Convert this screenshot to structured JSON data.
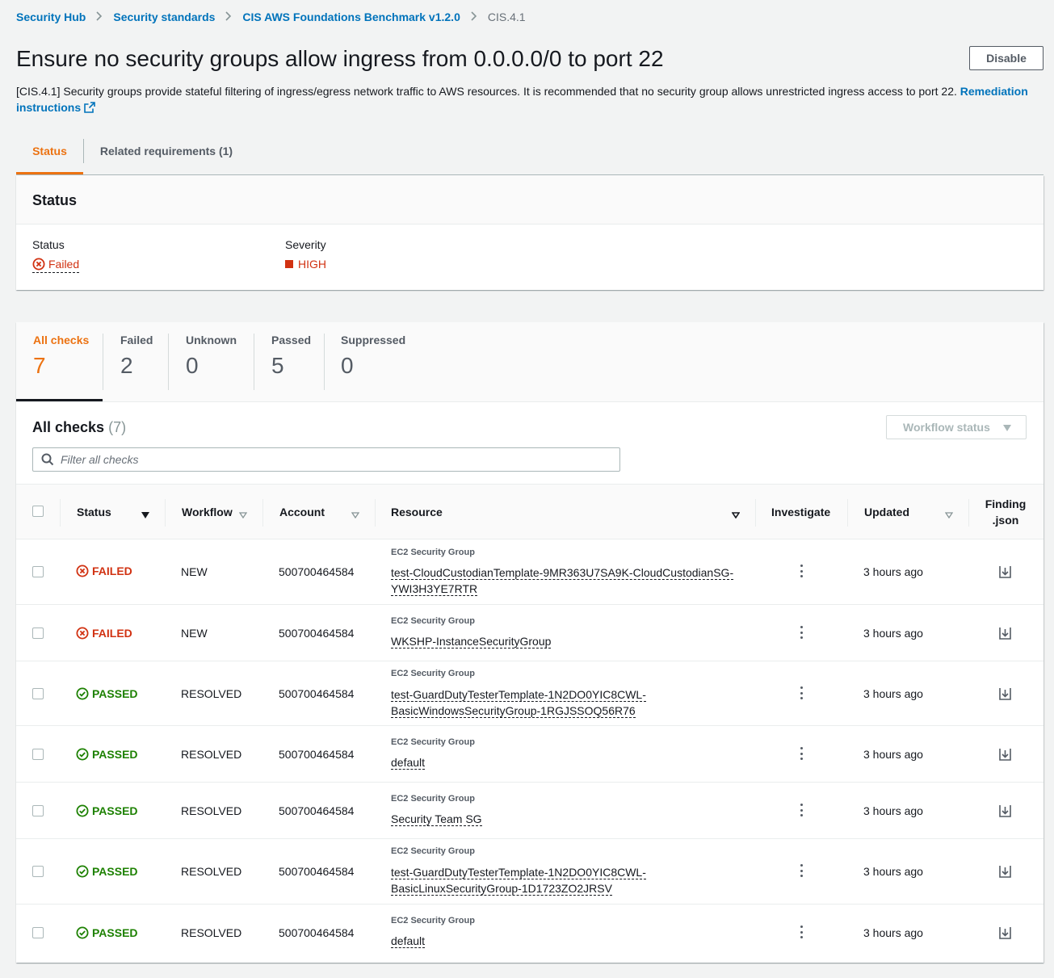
{
  "breadcrumb": {
    "items": [
      "Security Hub",
      "Security standards",
      "CIS AWS Foundations Benchmark v1.2.0"
    ],
    "current": "CIS.4.1"
  },
  "header": {
    "title": "Ensure no security groups allow ingress from 0.0.0.0/0 to port 22",
    "disable_label": "Disable",
    "description": "[CIS.4.1] Security groups provide stateful filtering of ingress/egress network traffic to AWS resources. It is recommended that no security group allows unrestricted ingress access to port 22.",
    "remediation_label": "Remediation instructions"
  },
  "tabs": [
    {
      "label": "Status",
      "active": true
    },
    {
      "label": "Related requirements (1)",
      "active": false
    }
  ],
  "status_panel": {
    "title": "Status",
    "status_key": "Status",
    "status_value": "Failed",
    "severity_key": "Severity",
    "severity_value": "HIGH"
  },
  "counts": [
    {
      "label": "All checks",
      "value": "7"
    },
    {
      "label": "Failed",
      "value": "2"
    },
    {
      "label": "Unknown",
      "value": "0"
    },
    {
      "label": "Passed",
      "value": "5"
    },
    {
      "label": "Suppressed",
      "value": "0"
    }
  ],
  "table": {
    "title": "All checks",
    "count": "(7)",
    "workflow_select": "Workflow status",
    "filter_placeholder": "Filter all checks",
    "columns": {
      "status": "Status",
      "workflow": "Workflow",
      "account": "Account",
      "resource": "Resource",
      "investigate": "Investigate",
      "updated": "Updated",
      "finding_1": "Finding",
      "finding_2": ".json"
    },
    "rows": [
      {
        "status": "FAILED",
        "workflow": "NEW",
        "account": "500700464584",
        "resource_type": "EC2 Security Group",
        "resource_line1": "test-CloudCustodianTemplate-9MR363U7SA9K-CloudCustodianSG-",
        "resource_line2": "YWI3H3YE7RTR",
        "updated": "3 hours ago"
      },
      {
        "status": "FAILED",
        "workflow": "NEW",
        "account": "500700464584",
        "resource_type": "EC2 Security Group",
        "resource_line1": "WKSHP-InstanceSecurityGroup",
        "resource_line2": "",
        "updated": "3 hours ago"
      },
      {
        "status": "PASSED",
        "workflow": "RESOLVED",
        "account": "500700464584",
        "resource_type": "EC2 Security Group",
        "resource_line1": "test-GuardDutyTesterTemplate-1N2DO0YIC8CWL-",
        "resource_line2": "BasicWindowsSecurityGroup-1RGJSSOQ56R76",
        "updated": "3 hours ago"
      },
      {
        "status": "PASSED",
        "workflow": "RESOLVED",
        "account": "500700464584",
        "resource_type": "EC2 Security Group",
        "resource_line1": "default",
        "resource_line2": "",
        "updated": "3 hours ago"
      },
      {
        "status": "PASSED",
        "workflow": "RESOLVED",
        "account": "500700464584",
        "resource_type": "EC2 Security Group",
        "resource_line1": "Security Team SG",
        "resource_line2": "",
        "updated": "3 hours ago"
      },
      {
        "status": "PASSED",
        "workflow": "RESOLVED",
        "account": "500700464584",
        "resource_type": "EC2 Security Group",
        "resource_line1": "test-GuardDutyTesterTemplate-1N2DO0YIC8CWL-",
        "resource_line2": "BasicLinuxSecurityGroup-1D1723ZO2JRSV",
        "updated": "3 hours ago"
      },
      {
        "status": "PASSED",
        "workflow": "RESOLVED",
        "account": "500700464584",
        "resource_type": "EC2 Security Group",
        "resource_line1": "default",
        "resource_line2": "",
        "updated": "3 hours ago"
      }
    ]
  },
  "colors": {
    "link": "#0073bb",
    "accent": "#ec7211",
    "failed": "#d13212",
    "passed": "#1d8102"
  },
  "icons": [
    "chevron-right-icon",
    "external-link-icon",
    "x-circle-icon",
    "severity-square-icon",
    "search-icon",
    "caret-down-icon",
    "kebab-menu-icon",
    "download-icon",
    "check-circle-icon"
  ]
}
